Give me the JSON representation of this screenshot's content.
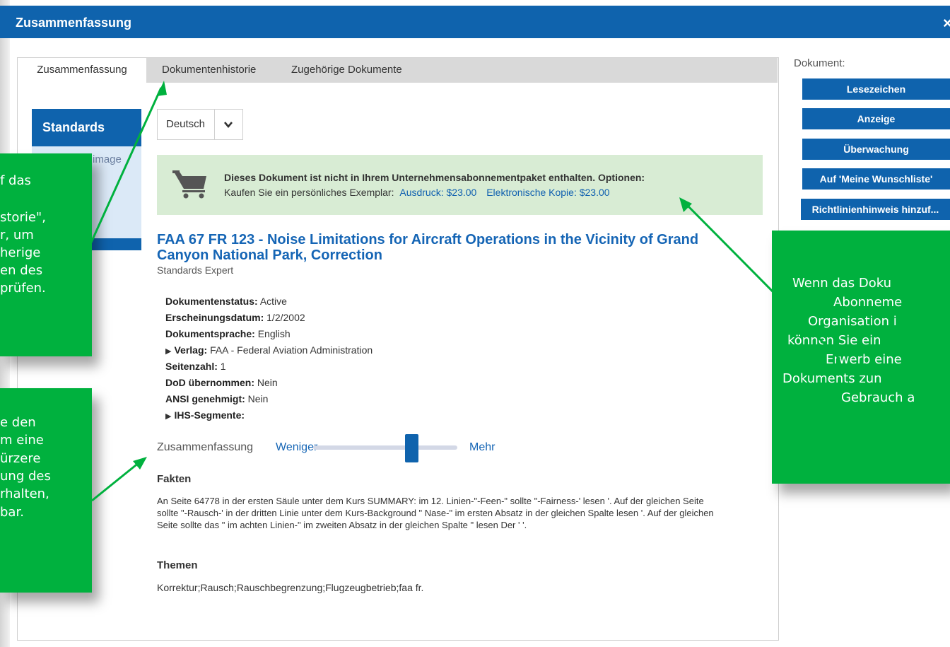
{
  "dialog": {
    "title": "Zusammenfassung",
    "close_icon": "×"
  },
  "tabs": [
    {
      "label": "Zusammenfassung",
      "active": true
    },
    {
      "label": "Dokumentenhistorie",
      "active": false
    },
    {
      "label": "Zugehörige Dokumente",
      "active": false
    }
  ],
  "sidebar": {
    "standards_label": "Standards",
    "image_label": "image"
  },
  "language_select": {
    "value": "Deutsch"
  },
  "notice": {
    "icon": "shopping-cart-icon",
    "line1": "Dieses Dokument ist nicht in Ihrem Unternehmensabonnementpaket enthalten. Optionen:",
    "line2_prefix": "Kaufen Sie ein persönliches Exemplar:",
    "print_link": "Ausdruck: $23.00",
    "electronic_link": "Elektronische Kopie: $23.00"
  },
  "document": {
    "title": "FAA 67 FR 123 - Noise Limitations for Aircraft Operations in the Vicinity of Grand Canyon National Park, Correction",
    "source": "Standards Expert",
    "status_label": "Dokumentenstatus:",
    "status_value": "Active",
    "date_label": "Erscheinungsdatum:",
    "date_value": "1/2/2002",
    "language_label": "Dokumentsprache:",
    "language_value": "English",
    "publisher_label": "Verlag:",
    "publisher_value": "FAA - Federal Aviation Administration",
    "pages_label": "Seitenzahl:",
    "pages_value": "1",
    "dod_label": "DoD übernommen:",
    "dod_value": "Nein",
    "ansi_label": "ANSI genehmigt:",
    "ansi_value": "Nein",
    "ihs_label": "IHS-Segmente:"
  },
  "summary_slider": {
    "label": "Zusammenfassung",
    "less": "Weniger",
    "more": "Mehr",
    "level": 0.7
  },
  "facts": {
    "heading": "Fakten",
    "text": "An Seite 64778 in der ersten Säule unter dem Kurs SUMMARY: im 12. Linien-\"-Feen-\" sollte \"-Fairness-' lesen '. Auf der gleichen Seite sollte \"-Rausch-' in der dritten Linie unter dem Kurs-Background \" Nase-\" im ersten Absatz in der gleichen Spalte lesen '. Auf der gleichen Seite sollte das \" im achten Linien-\" im zweiten Absatz in der gleichen Spalte \" lesen Der ' '."
  },
  "topics": {
    "heading": "Themen",
    "text": "Korrektur;Rausch;Rauschbegrenzung;Flugzeugbetrieb;faa fr."
  },
  "actions": {
    "label": "Dokument:",
    "buttons": [
      "Lesezeichen",
      "Anzeige",
      "Überwachung",
      "Auf 'Meine Wunschliste'",
      "Richtlinienhinweis hinzuf..."
    ]
  },
  "callouts": {
    "top_left": [
      "f das",
      "",
      "storie\",",
      "r, um",
      "herige",
      "en des",
      "prüfen."
    ],
    "bottom_left": [
      "e den",
      "m eine",
      "ürzere",
      "ung des",
      "rhalten,",
      "bar."
    ],
    "right": [
      "Wenn das Doku",
      "Abonneme",
      "Organisation i",
      "können Sie ein",
      "Erwerb eine",
      "Dokuments zun",
      "Gebrauch a"
    ]
  },
  "colors": {
    "brand_blue": "#0f63ad",
    "callout_green": "#00b13e",
    "notice_bg": "#d8ecd4",
    "link_blue": "#1565b5"
  }
}
